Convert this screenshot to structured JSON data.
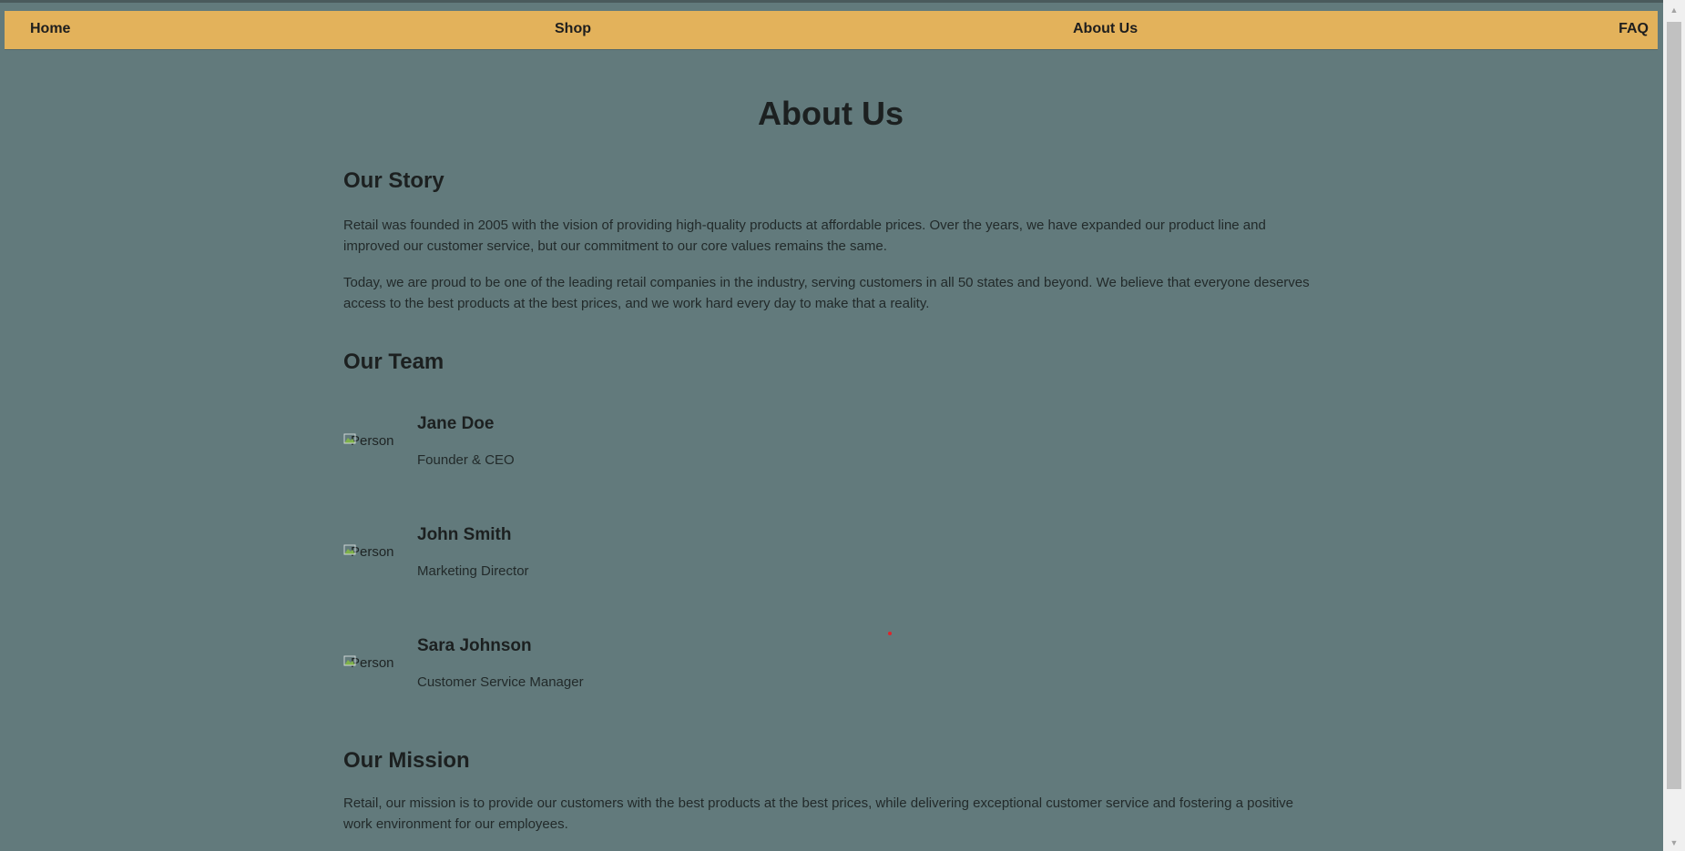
{
  "nav": {
    "home": "Home",
    "shop": "Shop",
    "about": "About Us",
    "faq": "FAQ"
  },
  "page": {
    "title": "About Us"
  },
  "story": {
    "heading": "Our Story",
    "p1": "Retail was founded in 2005 with the vision of providing high-quality products at affordable prices. Over the years, we have expanded our product line and improved our customer service, but our commitment to our core values remains the same.",
    "p2": "Today, we are proud to be one of the leading retail companies in the industry, serving customers in all 50 states and beyond. We believe that everyone deserves access to the best products at the best prices, and we work hard every day to make that a reality."
  },
  "team": {
    "heading": "Our Team",
    "members": [
      {
        "photo_alt": "Person",
        "name": "Jane Doe",
        "role": "Founder & CEO"
      },
      {
        "photo_alt": "Person",
        "name": "John Smith",
        "role": "Marketing Director"
      },
      {
        "photo_alt": "Person",
        "name": "Sara Johnson",
        "role": "Customer Service Manager"
      }
    ]
  },
  "mission": {
    "heading": "Our Mission",
    "p1": "Retail, our mission is to provide our customers with the best products at the best prices, while delivering exceptional customer service and fostering a positive work environment for our employees."
  },
  "icons": {
    "broken_image": "broken-image-icon",
    "scroll_up": "scroll-up-arrow-icon",
    "scroll_down": "scroll-down-arrow-icon"
  },
  "colors": {
    "background": "#627a7c",
    "navbar": "#e3b25b",
    "text": "#1c2020"
  }
}
